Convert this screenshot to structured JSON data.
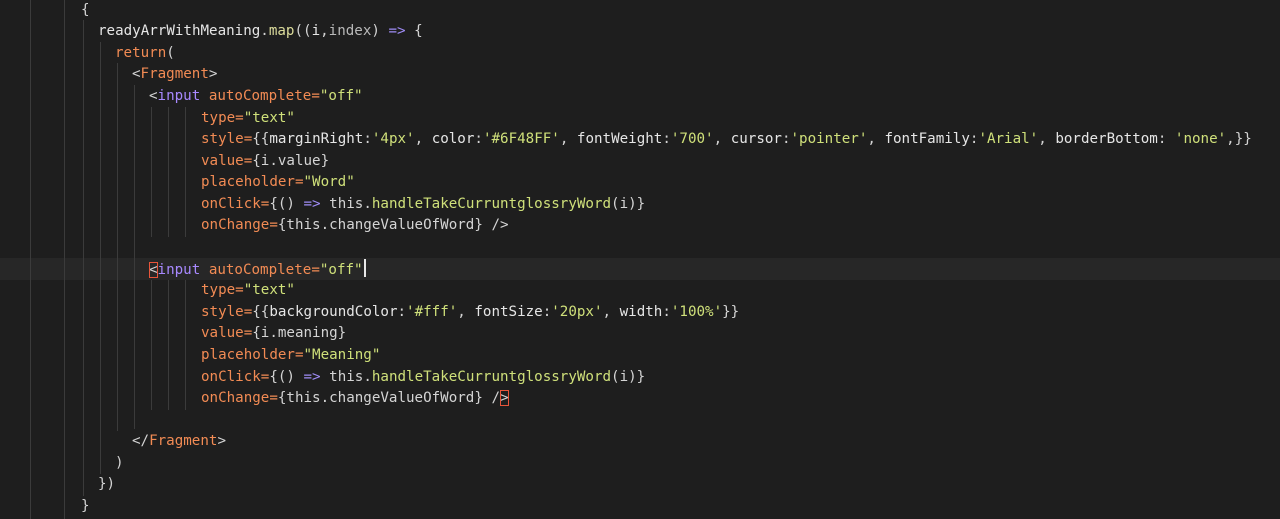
{
  "theme": {
    "background": "#1e1e1e",
    "current_line": "#272727",
    "keyword": "#f28b54",
    "string": "#cfe07a",
    "operator": "#9f8cf5",
    "bracket_highlight": "#e8553a"
  },
  "code": {
    "l1": "{",
    "l2": {
      "obj": "readyArrWithMeaning",
      "dot": ".",
      "fn": "map",
      "open": "((",
      "p1": "i",
      "comma": ",",
      "p2": "index",
      "close": ")",
      "arrow": "=>",
      "brace": "{"
    },
    "l3": {
      "kw": "return",
      "paren": "("
    },
    "l4": {
      "lt": "<",
      "tag": "Fragment",
      "gt": ">"
    },
    "l5": {
      "lt": "<",
      "tag": "input",
      "attr": "autoComplete",
      "eq": "=",
      "val": "\"off\""
    },
    "l6": {
      "attr": "type",
      "eq": "=",
      "val": "\"text\""
    },
    "l7": {
      "attr": "style",
      "eq": "=",
      "open": "{{",
      "k1": "marginRight",
      "v1": "'4px'",
      "k2": "color",
      "v2": "'#6F48FF'",
      "k3": "fontWeight",
      "v3": "'700'",
      "k4": "cursor",
      "v4": "'pointer'",
      "k5": "fontFamily",
      "v5": "'Arial'",
      "k6": "borderBottom",
      "v6": "'none'",
      "close": ",}}"
    },
    "l8": {
      "attr": "value",
      "eq": "=",
      "expr": "{i.value}"
    },
    "l9": {
      "attr": "placeholder",
      "eq": "=",
      "val": "\"Word\""
    },
    "l10": {
      "attr": "onClick",
      "eq": "=",
      "open": "{()",
      "arrow": "=>",
      "this": "this",
      "dot": ".",
      "method": "handleTakeCurruntglossryWord",
      "args": "(i)}"
    },
    "l11": {
      "attr": "onChange",
      "eq": "=",
      "expr": "{this.changeValueOfWord}",
      "end": "/>"
    },
    "l13": {
      "lt": "<",
      "tag": "input",
      "attr": "autoComplete",
      "eq": "=",
      "val": "\"off\""
    },
    "l14": {
      "attr": "type",
      "eq": "=",
      "val": "\"text\""
    },
    "l15": {
      "attr": "style",
      "eq": "=",
      "open": "{{",
      "k1": "backgroundColor",
      "v1": "'#fff'",
      "k2": "fontSize",
      "v2": "'20px'",
      "k3": "width",
      "v3": "'100%'",
      "close": "}}"
    },
    "l16": {
      "attr": "value",
      "eq": "=",
      "expr": "{i.meaning}"
    },
    "l17": {
      "attr": "placeholder",
      "eq": "=",
      "val": "\"Meaning\""
    },
    "l18": {
      "attr": "onClick",
      "eq": "=",
      "open": "{()",
      "arrow": "=>",
      "this": "this",
      "dot": ".",
      "method": "handleTakeCurruntglossryWord",
      "args": "(i)}"
    },
    "l19": {
      "attr": "onChange",
      "eq": "=",
      "expr": "{this.changeValueOfWord}",
      "slash": "/",
      "gt": ">"
    },
    "l21": {
      "lt": "</",
      "tag": "Fragment",
      "gt": ">"
    },
    "l22": ")",
    "l23": "})",
    "l24": "}"
  }
}
